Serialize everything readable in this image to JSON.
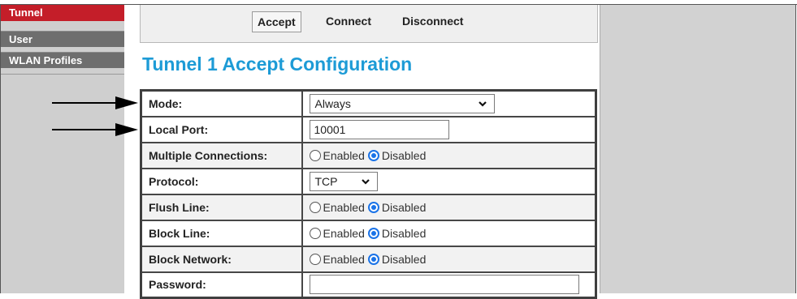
{
  "sidebar": {
    "items": [
      {
        "label": "Tunnel",
        "active": true
      },
      {
        "label": "User",
        "active": false
      },
      {
        "label": "WLAN Profiles",
        "active": false
      }
    ]
  },
  "tabs": [
    {
      "label": "Accept",
      "active": true
    },
    {
      "label": "Connect",
      "active": false
    },
    {
      "label": "Disconnect",
      "active": false
    }
  ],
  "page_title": "Tunnel 1 Accept Configuration",
  "form": {
    "mode": {
      "label": "Mode:",
      "value": "Always"
    },
    "local_port": {
      "label": "Local Port:",
      "value": "10001"
    },
    "multiple_connections": {
      "label": "Multiple Connections:",
      "enabled_label": "Enabled",
      "disabled_label": "Disabled",
      "selected": "Disabled"
    },
    "protocol": {
      "label": "Protocol:",
      "value": "TCP"
    },
    "flush_line": {
      "label": "Flush Line:",
      "enabled_label": "Enabled",
      "disabled_label": "Disabled",
      "selected": "Disabled"
    },
    "block_line": {
      "label": "Block Line:",
      "enabled_label": "Enabled",
      "disabled_label": "Disabled",
      "selected": "Disabled"
    },
    "block_network": {
      "label": "Block Network:",
      "enabled_label": "Enabled",
      "disabled_label": "Disabled",
      "selected": "Disabled"
    },
    "password": {
      "label": "Password:",
      "value": ""
    }
  },
  "colors": {
    "accent_red": "#c41e29",
    "title_blue": "#1d9bd6",
    "radio_blue": "#1a73e8"
  },
  "icons": [
    "arrow-right-icon",
    "chevron-down-icon"
  ]
}
